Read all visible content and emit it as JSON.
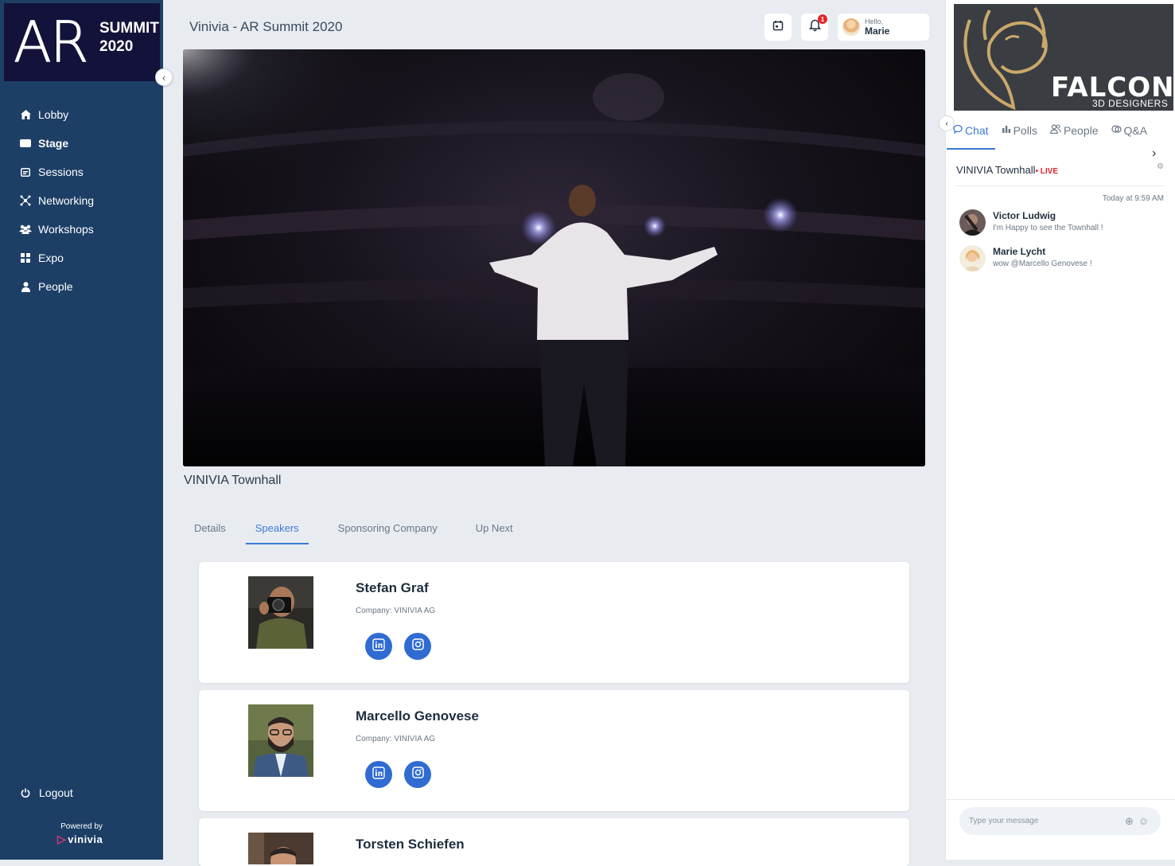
{
  "app": {
    "title": "Vinivia - AR Summit 2020"
  },
  "logo": {
    "big": "AR",
    "line1": "SUMMIT",
    "line2": "2020"
  },
  "sidebar": {
    "items": [
      {
        "label": "Lobby",
        "icon": "home-icon"
      },
      {
        "label": "Stage",
        "icon": "video-icon",
        "active": true
      },
      {
        "label": "Sessions",
        "icon": "calendar-icon"
      },
      {
        "label": "Networking",
        "icon": "network-icon"
      },
      {
        "label": "Workshops",
        "icon": "group-icon"
      },
      {
        "label": "Expo",
        "icon": "grid-icon"
      },
      {
        "label": "People",
        "icon": "person-icon"
      }
    ],
    "logout": "Logout",
    "powered_by": "Powered by",
    "brand": "vinivia"
  },
  "header": {
    "notification_count": "1",
    "greeting": "Hello,",
    "user_name": "Marie"
  },
  "stage": {
    "title": "VINIVIA Townhall"
  },
  "tabs": [
    {
      "label": "Details"
    },
    {
      "label": "Speakers",
      "active": true
    },
    {
      "label": "Sponsoring Company"
    },
    {
      "label": "Up Next"
    }
  ],
  "speakers": [
    {
      "name": "Stefan Graf",
      "company": "Company: VINIVIA AG"
    },
    {
      "name": "Marcello Genovese",
      "company": "Company: VINIVIA AG"
    },
    {
      "name": "Torsten Schiefen",
      "company": ""
    }
  ],
  "sponsor": {
    "name": "FALCON",
    "tagline": "3D DESIGNERS"
  },
  "right_tabs": [
    {
      "label": "Chat",
      "active": true,
      "icon": "chat-icon"
    },
    {
      "label": "Polls",
      "icon": "bar-chart-icon"
    },
    {
      "label": "People",
      "icon": "people-icon"
    },
    {
      "label": "Q&A",
      "icon": "qa-icon"
    }
  ],
  "chat": {
    "room": "VINIVIA Townhall",
    "live": "• LIVE",
    "time": "Today at 9:59 AM",
    "messages": [
      {
        "name": "Victor Ludwig",
        "text": "I'm Happy to see the Townhall !"
      },
      {
        "name": "Marie Lycht",
        "text": "wow @Marcello Genovese !"
      }
    ],
    "placeholder": "Type your message"
  },
  "colors": {
    "sidebar": "#1d3f66",
    "accent": "#3b7ad6",
    "live": "#e5252a"
  }
}
